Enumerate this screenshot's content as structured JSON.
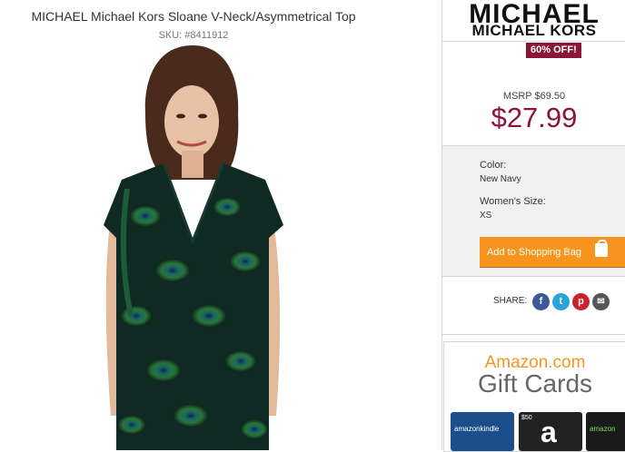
{
  "product": {
    "title": "MICHAEL Michael Kors Sloane V-Neck/Asymmetrical Top",
    "sku": "SKU: #8411912"
  },
  "brand": {
    "line1": "MICHAEL",
    "line2": "MICHAEL KORS"
  },
  "pricing": {
    "badge": "60% OFF!",
    "msrp": "MSRP $69.50",
    "price": "$27.99",
    "price_color": "#8b1538"
  },
  "options": {
    "color_label": "Color:",
    "color_value": "New Navy",
    "size_label": "Women's Size:",
    "size_value": "XS"
  },
  "cart": {
    "button_label": "Add to Shopping Bag",
    "button_color": "#f7941d"
  },
  "share": {
    "label": "SHARE:",
    "icons": [
      "facebook-icon",
      "twitter-icon",
      "pinterest-icon",
      "email-icon"
    ],
    "icon_glyphs": {
      "facebook": "f",
      "twitter": "t",
      "pinterest": "p",
      "email": "✉"
    }
  },
  "ad": {
    "line1": "Amazon.com",
    "line2": "Gift Cards",
    "card1_text": "amazonkindle",
    "card2_text": "$50",
    "card3_text": "amazon"
  }
}
